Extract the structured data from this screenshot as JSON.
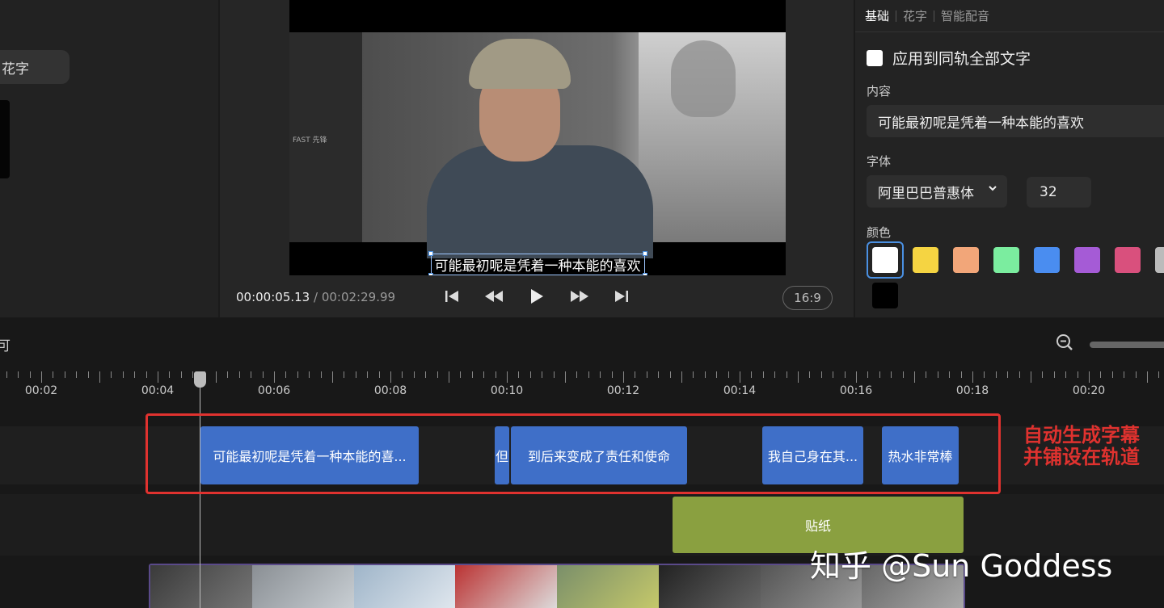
{
  "left_panel": {
    "chip_label": "花字"
  },
  "preview": {
    "subtitle": "可能最初呢是凭着一种本能的喜欢",
    "speaker_label": "FAST 先锋",
    "current_time": "00:00:05.13",
    "total_time": "/ 00:02:29.99",
    "aspect_ratio": "16:9",
    "controls": [
      "skip-to-start-icon",
      "rewind-icon",
      "play-icon",
      "fast-forward-icon",
      "skip-to-end-icon"
    ]
  },
  "right_panel": {
    "tabs": [
      "基础",
      "花字",
      "智能配音"
    ],
    "apply_all_label": "应用到同轨全部文字",
    "content_label": "内容",
    "content_value": "可能最初呢是凭着一种本能的喜欢",
    "font_label": "字体",
    "font_value": "阿里巴巴普惠体",
    "font_size": "32",
    "color_label": "颜色",
    "colors": [
      "#ffffff",
      "#f5d442",
      "#f2a679",
      "#7bed9f",
      "#4a8df0",
      "#a55bd6",
      "#d9507d",
      "#bbbbbb",
      "#000000"
    ]
  },
  "timeline": {
    "toolbar_char": "可",
    "ruler_labels": [
      "00:02",
      "00:04",
      "00:06",
      "00:08",
      "00:10",
      "00:12",
      "00:14",
      "00:16",
      "00:18",
      "00:20"
    ],
    "subtitle_clips": [
      "可能最初呢是凭着一种本能的喜...",
      "但",
      "到后来变成了责任和使命",
      "我自己身在其...",
      "热水非常棒"
    ],
    "sticker_label": "贴纸",
    "annotation_line1": "自动生成字幕",
    "annotation_line2": "并铺设在轨道",
    "watermark": "知乎 @Sun Goddess"
  }
}
